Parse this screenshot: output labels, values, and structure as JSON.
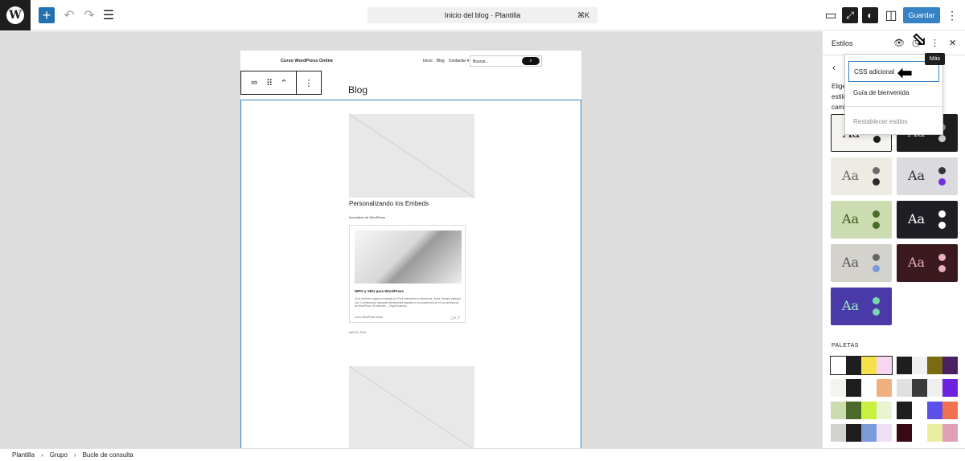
{
  "topbar": {
    "logo": "W",
    "add_icon": "+",
    "undo_icon": "↶",
    "redo_icon": "↷",
    "listview_icon": "☰",
    "document_title": "Inicio del blog · Plantilla",
    "shortcut": "⌘K",
    "view_icon": "▭",
    "zoom_icon": "⤢",
    "styles_icon": "◐",
    "sidebar_icon": "◫",
    "save_label": "Guardar",
    "more_icon": "⋮"
  },
  "page": {
    "site_title": "Curso WordPress Online",
    "nav": [
      "Inicio",
      "Blog",
      "Contactar ▾"
    ],
    "search_placeholder": "Buscar...",
    "search_icon": "⌕",
    "heading": "Blog",
    "block_toolbar": {
      "loop_icon": "∞",
      "drag_icon": "⠿",
      "move_icon": "⌃",
      "options_icon": "⋮"
    },
    "post_title": "Personalizando los Embeds",
    "post_meta": "Incrustado de WordPress",
    "embed": {
      "title": "WPO y SEO para WordPress",
      "excerpt": "En el reciente congreso realizado por Punt multimedia en Barcelona, Jesús Castaño participó con 2 conferencias realmente interesantes basadas en su experiencia en el uso profesional de WordPress. Mi intención ... Seguir leyendo",
      "author": "Curso WordPress Online",
      "icons": "◯0  ⤴"
    },
    "post_date": "abril 20, 2016"
  },
  "sidebar": {
    "title": "Estilos",
    "eye_icon": "👁",
    "history_icon": "◷",
    "more_icon": "⋮",
    "close_icon": "✕",
    "back_icon": "‹",
    "description": "Elige un estilo o cambia",
    "palettes_label": "PALETAS"
  },
  "dropdown": {
    "items": [
      "CSS adicional",
      "Guía de bienvenida",
      "Restablecer estilos"
    ],
    "tooltip": "Más"
  },
  "annotations": {
    "arrow_left": "⬅",
    "arrow_down": "⬂"
  },
  "breadcrumb": [
    "Plantilla",
    "Grupo",
    "Bucle de consulta"
  ],
  "breadcrumb_sep": "›",
  "style_variations": [
    {
      "bg": "#f5f3ef",
      "fg": "#1e1e1e",
      "d1": "#6a6a6a",
      "d2": "#1e1e1e",
      "aa": "Aa"
    },
    {
      "bg": "#1e1e1e",
      "fg": "#cfcfcf",
      "d1": "#8a8a8a",
      "d2": "#cfcfcf",
      "aa": "Aa"
    },
    {
      "bg": "#eeeae4",
      "fg": "#6b6b6b",
      "d1": "#6b6b6b",
      "d2": "#2a2a2a",
      "aa": "Aa"
    },
    {
      "bg": "#dadadf",
      "fg": "#333",
      "d1": "#333",
      "d2": "#7030e0",
      "aa": "Aa"
    },
    {
      "bg": "#cbdcb0",
      "fg": "#3a5a1e",
      "d1": "#4a6a2a",
      "d2": "#4a6a2a",
      "aa": "Aa"
    },
    {
      "bg": "#1e1e24",
      "fg": "#ffffff",
      "d1": "#ffffff",
      "d2": "#ffffff",
      "aa": "Aa"
    },
    {
      "bg": "#d4d2cc",
      "fg": "#555",
      "d1": "#666",
      "d2": "#7a9ad8",
      "aa": "Aa"
    },
    {
      "bg": "#3a1a1e",
      "fg": "#e8b0c0",
      "d1": "#e8b0c0",
      "d2": "#e8b0c0",
      "aa": "Aa"
    },
    {
      "bg": "#4a3aa8",
      "fg": "#a0e8c8",
      "d1": "#7ad8b0",
      "d2": "#7ad8b0",
      "aa": "Aa"
    }
  ],
  "palettes": [
    [
      "#ffffff",
      "#1e1e1e",
      "#f5e24a",
      "#f6d6f0"
    ],
    [
      "#1e1e1e",
      "#f0f0f0",
      "#7a6a10",
      "#4a2060"
    ],
    [
      "#f5f3ef",
      "#1e1e1e",
      "#ffffff",
      "#f0b080"
    ],
    [
      "#e0e0e0",
      "#3a3a3a",
      "#f0f0f0",
      "#7020e0"
    ],
    [
      "#cbdcb0",
      "#4a6a2a",
      "#c8f040",
      "#e8f5d0"
    ],
    [
      "#1e1e1e",
      "#ffffff",
      "#5a50e8",
      "#f07050"
    ],
    [
      "#d4d2cc",
      "#1e1e1e",
      "#7a9ad8",
      "#f0e0f5"
    ],
    [
      "#3a0a14",
      "#ffffff",
      "#e8f0a0",
      "#e0a0b8"
    ]
  ]
}
